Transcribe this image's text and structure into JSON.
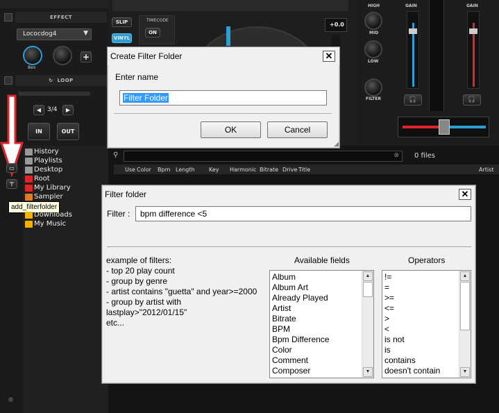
{
  "left_panel": {
    "effect_header": "EFFECT",
    "effect_name": "Lococdog4",
    "knob1_label": "8eo",
    "loop_header": "LOOP",
    "loop_value": "3/4",
    "in_label": "IN",
    "out_label": "OUT"
  },
  "deck_controls": {
    "slip": "SLIP",
    "vinyl": "VINYL",
    "timecode": "TIMECODE",
    "on": "ON",
    "pitch": "+0.0"
  },
  "mixer": {
    "high": "HIGH",
    "mid": "MID",
    "low": "LOW",
    "filter": "FILTER",
    "gain_left": "GAIN",
    "gain_right": "GAIN"
  },
  "browser": {
    "file_count": "0 files",
    "columns": [
      "Use",
      "Color",
      "Bpm",
      "Length",
      "Key",
      "Harmonic",
      "Bitrate",
      "Drive",
      "Title",
      "Artist"
    ],
    "tree": [
      {
        "label": "History",
        "color": "#9a9a9a"
      },
      {
        "label": "Playlists",
        "color": "#9a9a9a"
      },
      {
        "label": "Desktop",
        "color": "#9a9a9a"
      },
      {
        "label": "Root",
        "color": "#e0242a"
      },
      {
        "label": "My Library",
        "color": "#e0242a"
      },
      {
        "label": "Sampler",
        "color": "#e07a24"
      },
      {
        "label": "Downloads",
        "color": "#f0b400"
      },
      {
        "label": "My Music",
        "color": "#f0b400"
      }
    ],
    "tooltip": "add_filterfolder"
  },
  "create_dialog": {
    "title": "Create Filter Folder",
    "prompt": "Enter name",
    "value": "Filter Folder",
    "ok": "OK",
    "cancel": "Cancel"
  },
  "filter_dialog": {
    "title": "Filter folder",
    "filter_label": "Filter :",
    "filter_value": "bpm difference <5",
    "examples": [
      "example of filters:",
      "- top 20 play count",
      "- group by genre",
      "- artist contains \"guetta\" and year>=2000",
      "- group by artist with",
      "lastplay>\"2012/01/15\"",
      "etc..."
    ],
    "fields_title": "Available fields",
    "fields": [
      "Album",
      "Album Art",
      "Already Played",
      "Artist",
      "Bitrate",
      "BPM",
      "Bpm Difference",
      "Color",
      "Comment",
      "Composer"
    ],
    "operators_title": "Operators",
    "operators": [
      "!=",
      "=",
      ">=",
      "<=",
      ">",
      "<",
      "is not",
      "is",
      "contains",
      "doesn't contain"
    ]
  },
  "colors": {
    "accent_blue": "#2a9fd6",
    "fader_red": "#e0242a"
  }
}
